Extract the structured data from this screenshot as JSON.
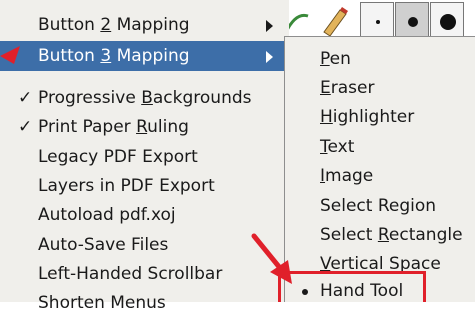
{
  "menu": {
    "items": [
      {
        "pre": "Button ",
        "mn": "2",
        "post": " Mapping",
        "check": "",
        "submenu": true,
        "highlighted": false
      },
      {
        "pre": "Button ",
        "mn": "3",
        "post": " Mapping",
        "check": "",
        "submenu": true,
        "highlighted": true
      },
      {
        "pre": "Progressive ",
        "mn": "B",
        "post": "ackgrounds",
        "check": "✓",
        "submenu": false,
        "highlighted": false
      },
      {
        "pre": "Print Paper ",
        "mn": "R",
        "post": "uling",
        "check": "✓",
        "submenu": false,
        "highlighted": false
      },
      {
        "pre": "Legacy PDF Export",
        "mn": "",
        "post": "",
        "check": "",
        "submenu": false,
        "highlighted": false
      },
      {
        "pre": "Layers in PDF Export",
        "mn": "",
        "post": "",
        "check": "",
        "submenu": false,
        "highlighted": false
      },
      {
        "pre": "Autoload pdf.xoj",
        "mn": "",
        "post": "",
        "check": "",
        "submenu": false,
        "highlighted": false
      },
      {
        "pre": "Auto-Save Files",
        "mn": "",
        "post": "",
        "check": "",
        "submenu": false,
        "highlighted": false
      },
      {
        "pre": "Left-Handed Scrollbar",
        "mn": "",
        "post": "",
        "check": "",
        "submenu": false,
        "highlighted": false
      },
      {
        "pre": "Shorten Menus",
        "mn": "",
        "post": "",
        "check": "",
        "submenu": false,
        "highlighted": false
      }
    ]
  },
  "submenu": {
    "items": [
      {
        "pre": "",
        "mn": "P",
        "post": "en",
        "selected": false
      },
      {
        "pre": "",
        "mn": "E",
        "post": "raser",
        "selected": false
      },
      {
        "pre": "",
        "mn": "H",
        "post": "ighlighter",
        "selected": false
      },
      {
        "pre": "",
        "mn": "T",
        "post": "ext",
        "selected": false
      },
      {
        "pre": "",
        "mn": "I",
        "post": "mage",
        "selected": false
      },
      {
        "pre": "Select Region",
        "mn": "",
        "post": "",
        "selected": false
      },
      {
        "pre": "Select ",
        "mn": "R",
        "post": "ectangle",
        "selected": false
      },
      {
        "pre": "",
        "mn": "V",
        "post": "ertical Space",
        "selected": false
      },
      {
        "pre": "Hand Tool",
        "mn": "",
        "post": "",
        "selected": true
      }
    ]
  },
  "colors": {
    "menu_bg": "#f0efeb",
    "highlight_bg": "#3d6ea8",
    "annotation_red": "#e0202a"
  },
  "toolbar": {
    "icons": [
      "pen-tool-icon",
      "pencil-icon",
      "small-dot-icon",
      "medium-dot-icon",
      "large-dot-icon"
    ]
  }
}
